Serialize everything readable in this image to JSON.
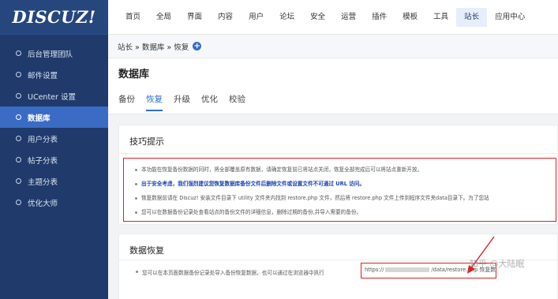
{
  "app": {
    "logo_text": "DISCUZ!"
  },
  "sidebar": {
    "items": [
      {
        "label": "后台管理团队"
      },
      {
        "label": "邮件设置"
      },
      {
        "label": "UCenter 设置"
      },
      {
        "label": "数据库"
      },
      {
        "label": "用户分表"
      },
      {
        "label": "帖子分表"
      },
      {
        "label": "主题分表"
      },
      {
        "label": "优化大师"
      }
    ],
    "active_index": 3
  },
  "topnav": {
    "items": [
      "首页",
      "全局",
      "界面",
      "内容",
      "用户",
      "论坛",
      "安全",
      "运营",
      "插件",
      "模板",
      "工具",
      "站长",
      "应用中心"
    ],
    "active_index": 11
  },
  "breadcrumb": {
    "text": "站长 » 数据库 » 恢复"
  },
  "page": {
    "title": "数据库",
    "tabs": [
      "备份",
      "恢复",
      "升级",
      "优化",
      "校验"
    ],
    "active_tab": 1
  },
  "tips_panel": {
    "title": "技巧提示",
    "tips": [
      "本功能在恢复备份数据的同时，将全部覆盖原有数据，请确定恢复前已将站点关闭，恢复全部完成后可以将站点重新开放。",
      "出于安全考虑，我们强烈建议您恢复数据库备份文件后删除文件或设置文件不可通过 URL 访问。",
      "恢复数据前请在 Discuz! 安装文件目录下 utility 文件夹内找到 restore.php 文件，然后将 restore.php 文件上传到程序文件夹data目录下。为了您站",
      "您可以在数据备份记录处查看站点的备份文件的详细信息，删除过期的备份,并导入需要的备份。"
    ]
  },
  "restore_panel": {
    "title": "数据恢复",
    "line": "您可以在本页面数据备份记录处导入备份恢复数据，也可以通过在浏览器中执行",
    "url_prefix": "https://",
    "url_suffix": "/data/restore.php 恢复数据"
  },
  "watermark": {
    "text": "知乎 @大陆眠"
  },
  "colors": {
    "sidebar_bg": "#1f3a6b",
    "sidebar_active": "#3a6bc5",
    "tab_active": "#2b6fd6",
    "highlight_box": "#e02020"
  }
}
